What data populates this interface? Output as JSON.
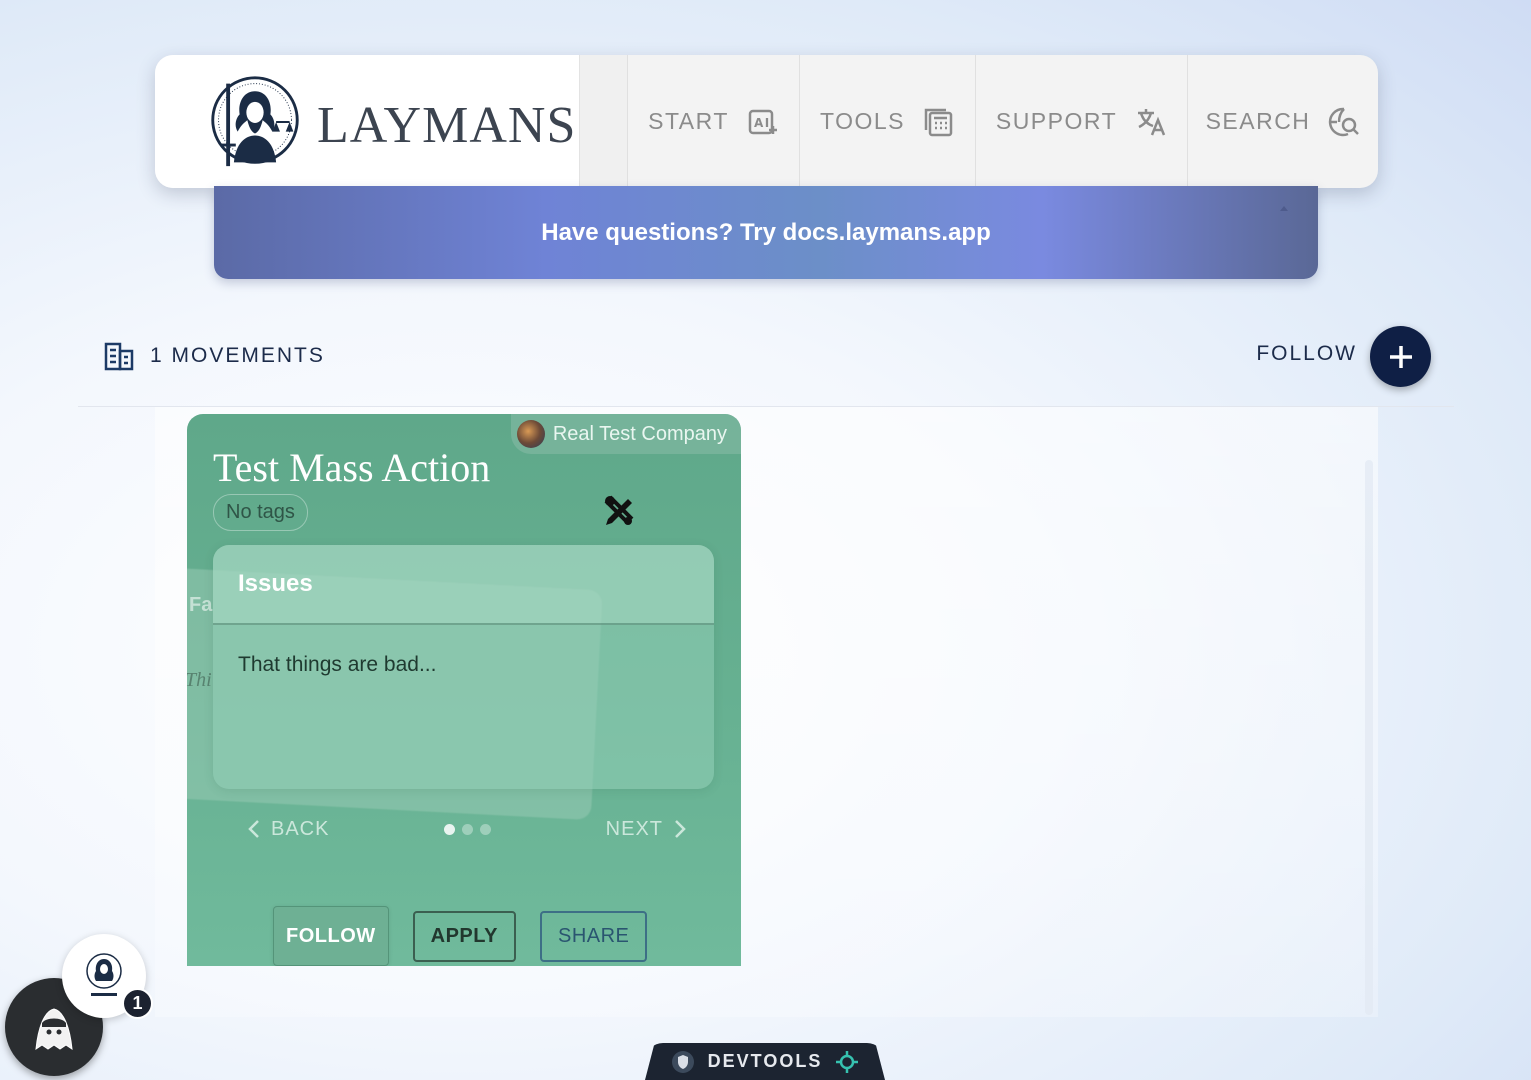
{
  "nav": {
    "brand": "LAYMANS",
    "items": [
      {
        "label": "START",
        "icon": "ai-spark-icon"
      },
      {
        "label": "TOOLS",
        "icon": "calculator-icon"
      },
      {
        "label": "SUPPORT",
        "icon": "translate-icon"
      },
      {
        "label": "SEARCH",
        "icon": "search-globe-icon"
      }
    ]
  },
  "banner": {
    "text": "Have questions? Try docs.laymans.app"
  },
  "section": {
    "count_label": "1 MOVEMENTS",
    "follow_label": "FOLLOW"
  },
  "card": {
    "company": "Real Test Company",
    "title": "Test Mass Action",
    "tag": "No tags",
    "ghost_heading": "Fa",
    "ghost_text": "Thi",
    "issue_heading": "Issues",
    "issue_text": "That things are bad...",
    "back_label": "BACK",
    "next_label": "NEXT",
    "page_count": 3,
    "active_page": 1,
    "follow_btn": "FOLLOW",
    "apply_btn": "APPLY",
    "share_btn": "SHARE"
  },
  "widgets": {
    "notif_count": "1",
    "devtools_label": "DEVTOOLS"
  },
  "colors": {
    "card": "#66b091",
    "navy": "#0f1f45",
    "banner": "#6f83d6"
  }
}
